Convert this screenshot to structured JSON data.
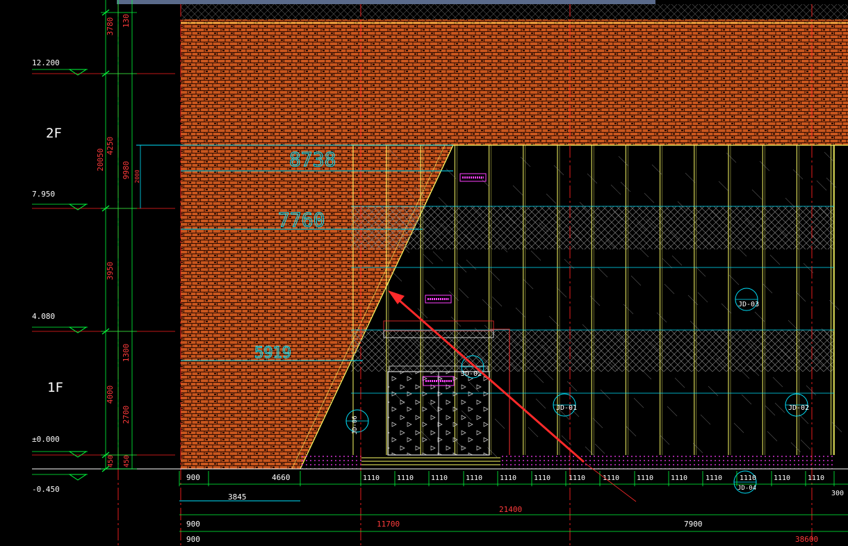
{
  "drawing": {
    "colors": {
      "background": "#000000",
      "brick": "#c8561e",
      "brick_mortar": "#1a0800",
      "grid_line": "#ff2020",
      "dim_green": "#00ff3c",
      "dim_cyan": "#00e5ff",
      "glass_frame": "#ffff66",
      "hatch": "#8a8a8a",
      "tag": "#ff40ff",
      "arrow": "#ff2a2a",
      "sky_strip": "#5a6a8a"
    },
    "elevations": [
      {
        "label": "12.200"
      },
      {
        "label": "7.950"
      },
      {
        "label": "4.080"
      },
      {
        "label": "±0.000"
      },
      {
        "label": "-0.450"
      }
    ],
    "floors": [
      {
        "label": "2F"
      },
      {
        "label": "1F"
      }
    ],
    "left_dims_outer": [
      {
        "label": "3780"
      },
      {
        "label": "4250"
      },
      {
        "label": "3950"
      },
      {
        "label": "4000"
      },
      {
        "label": "450"
      }
    ],
    "left_dims_middle": [
      {
        "label": "130"
      },
      {
        "label": "9980"
      },
      {
        "label": "1300"
      },
      {
        "label": "2700"
      },
      {
        "label": "450"
      }
    ],
    "left_total": "20050",
    "small_dim": "2000",
    "diagonal_dims": [
      {
        "label": "8738"
      },
      {
        "label": "7760"
      },
      {
        "label": "5919"
      }
    ],
    "bottom_dim_row1": [
      "900",
      "4660",
      "1110",
      "1110",
      "1110",
      "1110",
      "1110",
      "1110",
      "1110",
      "1110",
      "1110",
      "1110",
      "1110",
      "1110",
      "1110",
      "1110"
    ],
    "bottom_dim_3845": "3845",
    "bottom_dim_21400": "21400",
    "bottom_dim_300": "300",
    "bottom_dim_row3": [
      "900",
      "11700",
      "7900"
    ],
    "bottom_dim_row4": [
      "900",
      "38600"
    ],
    "window_tags": [
      {
        "label": "JD-02"
      },
      {
        "label": "JD-01"
      },
      {
        "label": "JD-02"
      },
      {
        "label": "JD-03"
      },
      {
        "label": "JD-04"
      },
      {
        "label": "JD-06"
      }
    ]
  }
}
